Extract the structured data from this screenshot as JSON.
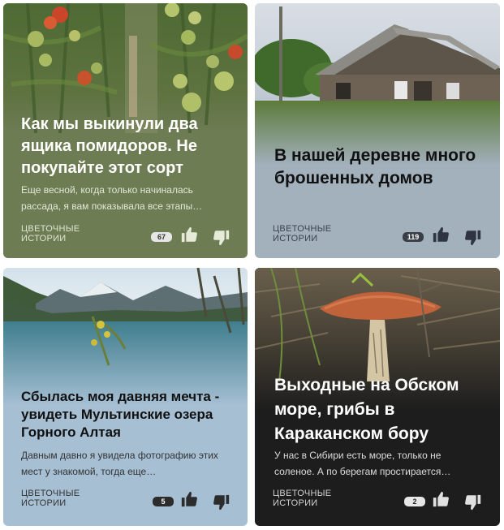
{
  "cards": [
    {
      "title": "Как мы выкинули два ящика помидоров. Не покупайте этот сорт",
      "description": "Еще весной, когда только начиналась рассада, я вам показывала все этапы…",
      "channel": "Цветочные истории",
      "comments": "67",
      "image": "tomato-plants-photo"
    },
    {
      "title": "В нашей деревне много брошенных домов",
      "description": "",
      "channel": "Цветочные истории",
      "comments": "119",
      "image": "abandoned-wooden-house-photo"
    },
    {
      "title": "Сбылась моя давняя мечта - увидеть Мультинские озера Горного Алтая",
      "description": "Давным давно я увидела фотографию этих мест у знакомой, тогда еще…",
      "channel": "Цветочные истории",
      "comments": "5",
      "image": "mountain-lake-photo"
    },
    {
      "title": "Выходные на Обском море, грибы в Караканском бору",
      "description": "У нас в Сибири есть море, только не соленое. А по берегам простирается…",
      "channel": "Цветочные истории",
      "comments": "2",
      "image": "mushroom-photo"
    }
  ],
  "icons": {
    "like": "thumbs-up-icon",
    "dislike": "thumbs-down-icon",
    "comments": "comment-count-badge"
  },
  "colors": {
    "card1_bg": "#6e7c54",
    "card2_bg": "#a3b1bd",
    "card3_bg": "#a6bfd3",
    "card4_bg": "#1d1d1d"
  }
}
